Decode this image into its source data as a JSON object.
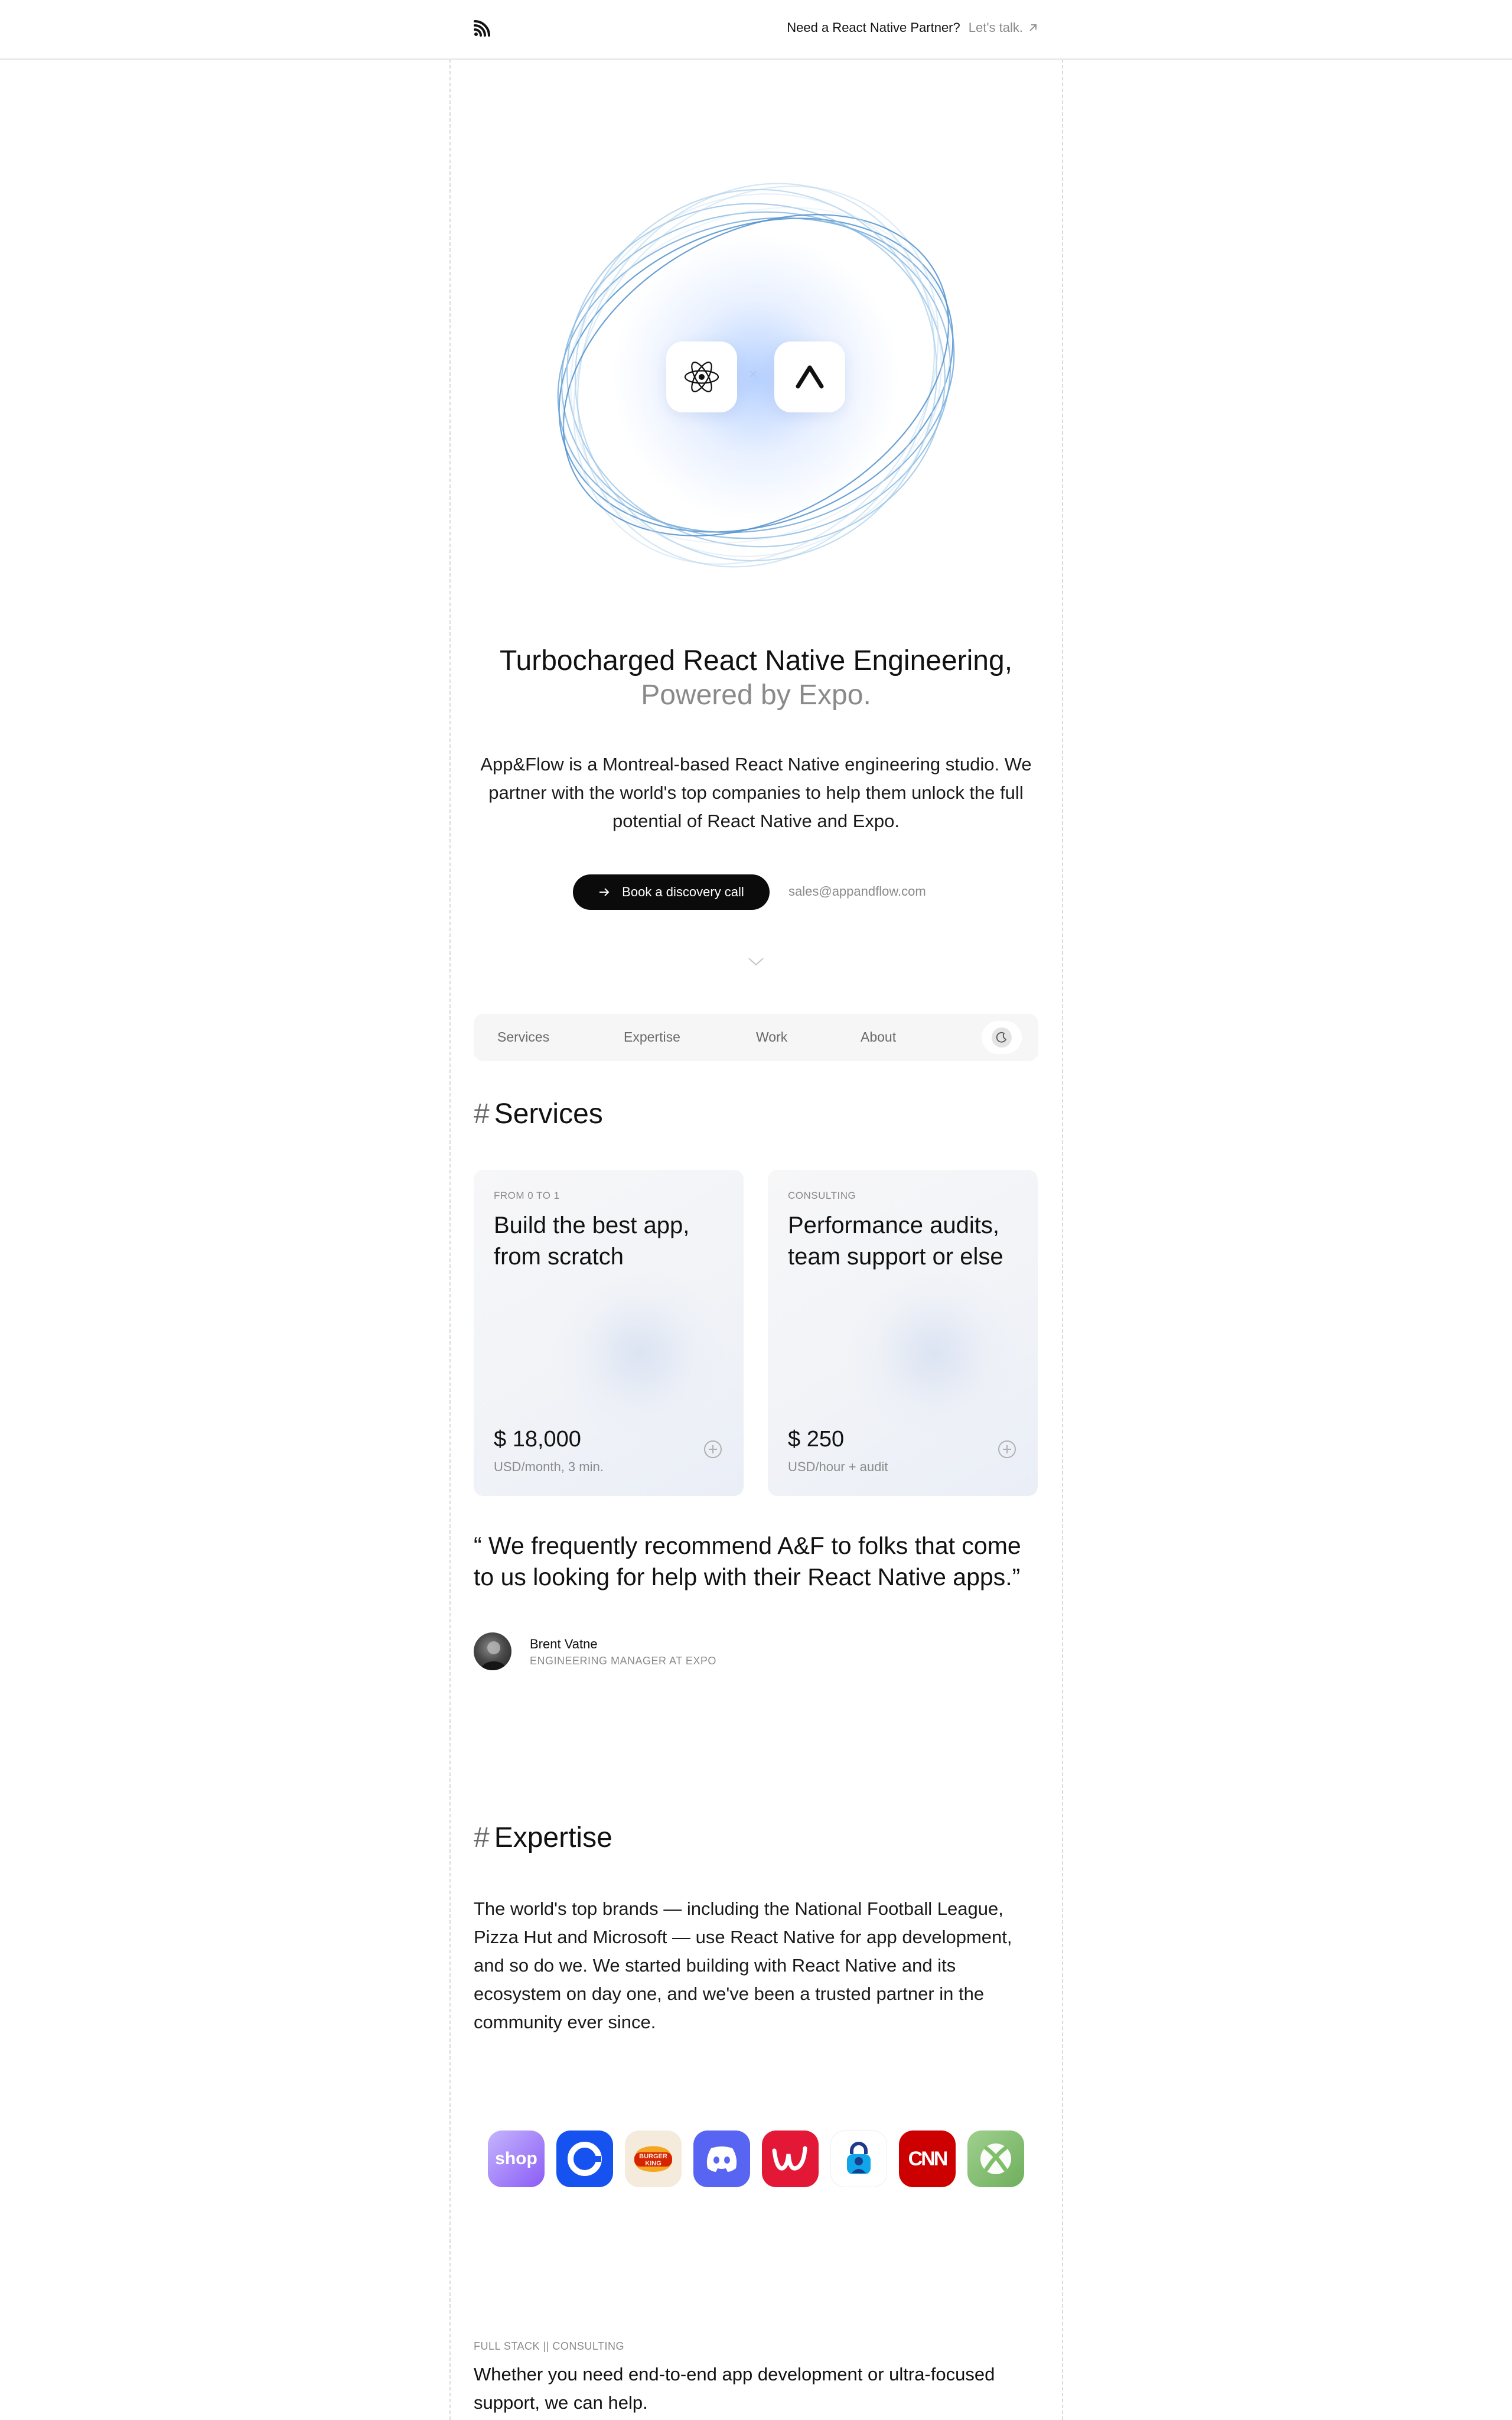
{
  "header": {
    "cta_question": "Need a React Native Partner?",
    "cta_link": "Let's talk."
  },
  "hero": {
    "title_main": "Turbocharged React Native Engineering,",
    "title_sub": "Powered by Expo.",
    "separator": "×",
    "description": "App&Flow is a Montreal-based React Native engineering studio. We partner with the world's top companies to help them unlock the full potential of React Native and Expo.",
    "primary_button": "Book a discovery call",
    "email": "sales@appandflow.com"
  },
  "nav": {
    "items": [
      "Services",
      "Expertise",
      "Work",
      "About"
    ]
  },
  "services": {
    "heading_hash": "#",
    "heading": "Services",
    "cards": [
      {
        "tag": "FROM 0 TO 1",
        "title": "Build the best app, from scratch",
        "price": "$ 18,000",
        "unit": "USD/month, 3 min."
      },
      {
        "tag": "CONSULTING",
        "title": "Performance audits, team support or else",
        "price": "$ 250",
        "unit": "USD/hour + audit"
      }
    ]
  },
  "testimonial": {
    "quote": "“ We frequently recommend A&F to folks that come to us looking for help with their React Native apps.”",
    "name": "Brent Vatne",
    "role": "ENGINEERING MANAGER AT EXPO"
  },
  "expertise": {
    "heading_hash": "#",
    "heading": "Expertise",
    "text": "The world's top brands — including the National Football League, Pizza Hut and Microsoft — use React Native for app development, and so do we. We started building with React Native and its ecosystem on day one, and we've been a trusted partner in the community ever since.",
    "brands": [
      {
        "name": "shop-logo",
        "label": "shop",
        "color": "#a78bfa"
      },
      {
        "name": "coinbase-logo",
        "label": "",
        "color": "#1652f0"
      },
      {
        "name": "burger-king-logo",
        "label": "BURGER KING",
        "color": "#f5ebdc"
      },
      {
        "name": "discord-logo",
        "label": "",
        "color": "#5865f2"
      },
      {
        "name": "walgreens-logo",
        "label": "",
        "color": "#e31837"
      },
      {
        "name": "security-app-logo",
        "label": "",
        "color": "#ffffff"
      },
      {
        "name": "cnn-logo",
        "label": "CNN",
        "color": "#cc0000"
      },
      {
        "name": "xbox-logo",
        "label": "",
        "color": "#7fbf6a"
      }
    ]
  },
  "full_stack": {
    "tag": "FULL STACK || CONSULTING",
    "text": "Whether you need end-to-end app development or ultra-focused support, we can help."
  }
}
